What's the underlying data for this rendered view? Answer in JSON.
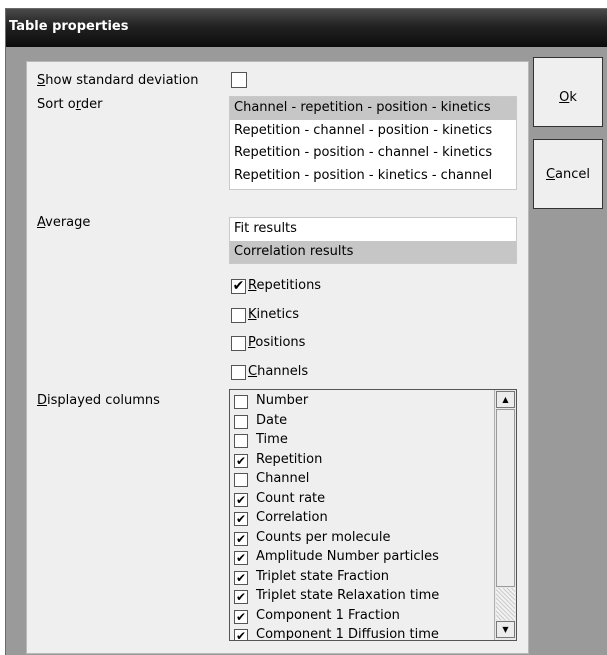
{
  "window": {
    "title": "Table properties"
  },
  "settings": {
    "show_std_label_pre": "",
    "show_std_label_ul": "S",
    "show_std_label_post": "how standard deviation",
    "sort_order_label_pre": "Sort o",
    "sort_order_label_ul": "r",
    "sort_order_label_post": "der",
    "sort_orders": [
      "Channel - repetition - position - kinetics",
      "Repetition - channel - position - kinetics",
      "Repetition - position - channel - kinetics",
      "Repetition - position - kinetics - channel"
    ],
    "average_label_ul": "A",
    "average_label_post": "verage",
    "average_options": [
      "Fit results",
      "Correlation results"
    ],
    "repetitions": {
      "ul": "R",
      "rest": "epetitions",
      "checked": true
    },
    "kinetics": {
      "ul": "K",
      "rest": "inetics",
      "checked": false
    },
    "positions": {
      "ul": "P",
      "rest": "ositions",
      "checked": false
    },
    "channels": {
      "ul": "C",
      "rest": "hannels",
      "checked": false
    },
    "displayed_columns_label_ul": "D",
    "displayed_columns_label_post": "isplayed columns"
  },
  "columns": [
    {
      "label": "Number",
      "checked": false
    },
    {
      "label": "Date",
      "checked": false
    },
    {
      "label": "Time",
      "checked": false
    },
    {
      "label": "Repetition",
      "checked": true
    },
    {
      "label": "Channel",
      "checked": false
    },
    {
      "label": "Count rate",
      "checked": true
    },
    {
      "label": "Correlation",
      "checked": true
    },
    {
      "label": "Counts per molecule",
      "checked": true
    },
    {
      "label": "Amplitude Number particles",
      "checked": true
    },
    {
      "label": "Triplet state Fraction",
      "checked": true
    },
    {
      "label": "Triplet state Relaxation time",
      "checked": true
    },
    {
      "label": "Component 1 Fraction",
      "checked": true
    },
    {
      "label": "Component 1 Diffusion time",
      "checked": true
    }
  ],
  "buttons": {
    "ok_ul": "O",
    "ok_rest": "k",
    "cancel_ul": "C",
    "cancel_rest": "ancel"
  },
  "checkmark": "✔",
  "scroll_up": "▲",
  "scroll_down": "▼"
}
